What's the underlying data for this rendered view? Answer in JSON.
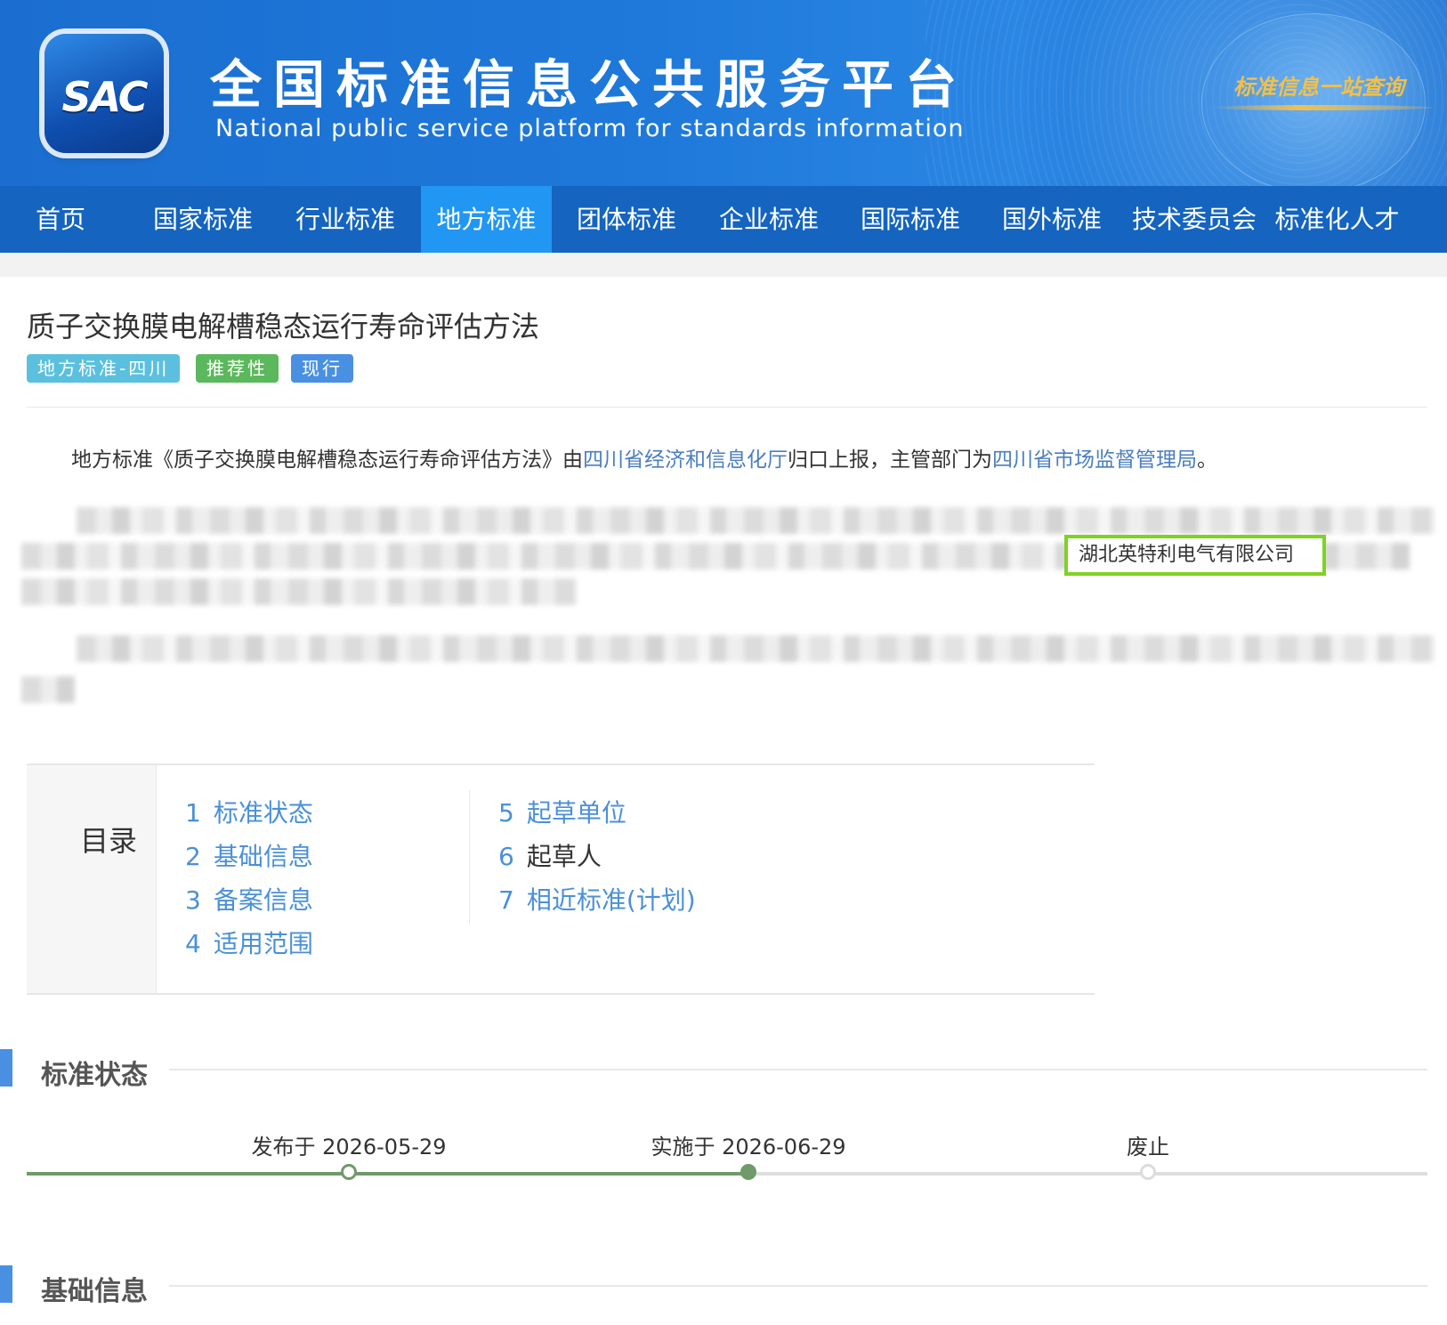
{
  "header": {
    "logo_text": "SAC",
    "title_cn": "全国标准信息公共服务平台",
    "title_en": "National public service platform  for standards information",
    "slogan": "标准信息一站查询"
  },
  "nav": {
    "items": [
      "首页",
      "国家标准",
      "行业标准",
      "地方标准",
      "团体标准",
      "企业标准",
      "国际标准",
      "国外标准",
      "技术委员会",
      "标准化人才"
    ],
    "active": "地方标准"
  },
  "standard": {
    "title": "质子交换膜电解槽稳态运行寿命评估方法",
    "tags": [
      "地方标准-四川",
      "推荐性",
      "现行"
    ],
    "desc_prefix": "地方标准《质子交换膜电解槽稳态运行寿命评估方法》由",
    "desc_org1": "四川省经济和信息化厅",
    "desc_mid": "归口上报，主管部门为",
    "desc_org2": "四川省市场监督管理局",
    "desc_suffix": "。",
    "highlighted_company": "湖北英特利电气有限公司"
  },
  "toc": {
    "label": "目录",
    "items": [
      {
        "num": "1",
        "label": "标准状态"
      },
      {
        "num": "2",
        "label": "基础信息"
      },
      {
        "num": "3",
        "label": "备案信息"
      },
      {
        "num": "4",
        "label": "适用范围"
      },
      {
        "num": "5",
        "label": "起草单位"
      },
      {
        "num": "6",
        "label": "起草人"
      },
      {
        "num": "7",
        "label": "相近标准(计划)"
      }
    ]
  },
  "sections": {
    "status_title": "标准状态",
    "basic_title": "基础信息"
  },
  "timeline": {
    "published": "发布于 2026-05-29",
    "implemented": "实施于 2026-06-29",
    "abolished": "废止",
    "progress_stage": "implemented"
  },
  "colors": {
    "banner_blue": "#1e79da",
    "nav_blue": "#1464c0",
    "nav_active": "#2196f3",
    "link": "#4a7ec2",
    "highlight_border": "#7ed321",
    "timeline_green": "#6f9a6a"
  }
}
